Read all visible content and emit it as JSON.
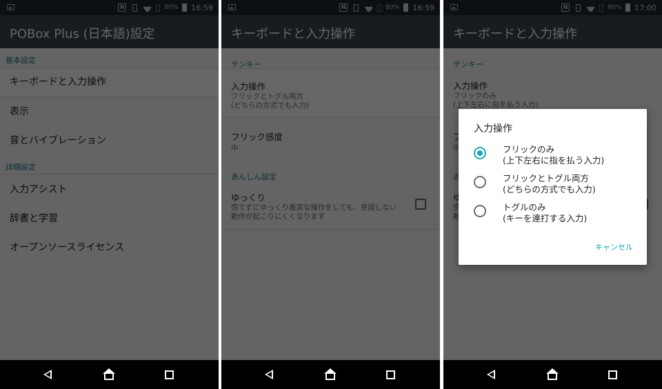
{
  "status_bars": [
    {
      "battery": "80%",
      "time": "16:59"
    },
    {
      "battery": "80%",
      "time": "16:59"
    },
    {
      "battery": "80%",
      "time": "17:00"
    }
  ],
  "screen1": {
    "title": "POBox Plus (日本語)設定",
    "sections": [
      {
        "header": "基本設定",
        "items": [
          "キーボードと入力操作",
          "表示",
          "音とバイブレーション"
        ]
      },
      {
        "header": "詳細設定",
        "items": [
          "入力アシスト",
          "辞書と学習",
          "オープンソースライセンス"
        ]
      }
    ]
  },
  "screen2": {
    "title": "キーボードと入力操作",
    "section1_header": "テンキー",
    "input_op": {
      "title": "入力操作",
      "summary1": "フリックとトグル両方",
      "summary2": "(どちらの方式でも入力)"
    },
    "flick": {
      "title": "フリック感度",
      "summary": "中"
    },
    "section2_header": "あんしん設定",
    "slow": {
      "title": "ゆっくり",
      "summary1": "慌てずにゆっくり着実な操作をしても、意図しない",
      "summary2": "動作が起こりにくくなります",
      "checked": false
    }
  },
  "screen3": {
    "title": "キーボードと入力操作",
    "section1_header": "テンキー",
    "input_op": {
      "title": "入力操作",
      "summary1": "フリックのみ",
      "summary2": "(上下左右に指を払う入力)"
    },
    "flick_partial": "フ",
    "flick_summary_partial": "中",
    "section2_partial": "あ",
    "slow_partial": "ゆ",
    "slow_sum1_partial": "慌",
    "slow_sum2_partial": "動",
    "dialog": {
      "title": "入力操作",
      "options": [
        {
          "line1": "フリックのみ",
          "line2": "(上下左右に指を払う入力)",
          "selected": true
        },
        {
          "line1": "フリックとトグル両方",
          "line2": "(どちらの方式でも入力)",
          "selected": false
        },
        {
          "line1": "トグルのみ",
          "line2": "(キーを連打する入力)",
          "selected": false
        }
      ],
      "cancel": "キャンセル"
    }
  },
  "colors": {
    "appbar": "#37474f",
    "accent": "#1aa8b4",
    "section_header": "#1e7a8a",
    "statusbar": "#1f2a30"
  }
}
